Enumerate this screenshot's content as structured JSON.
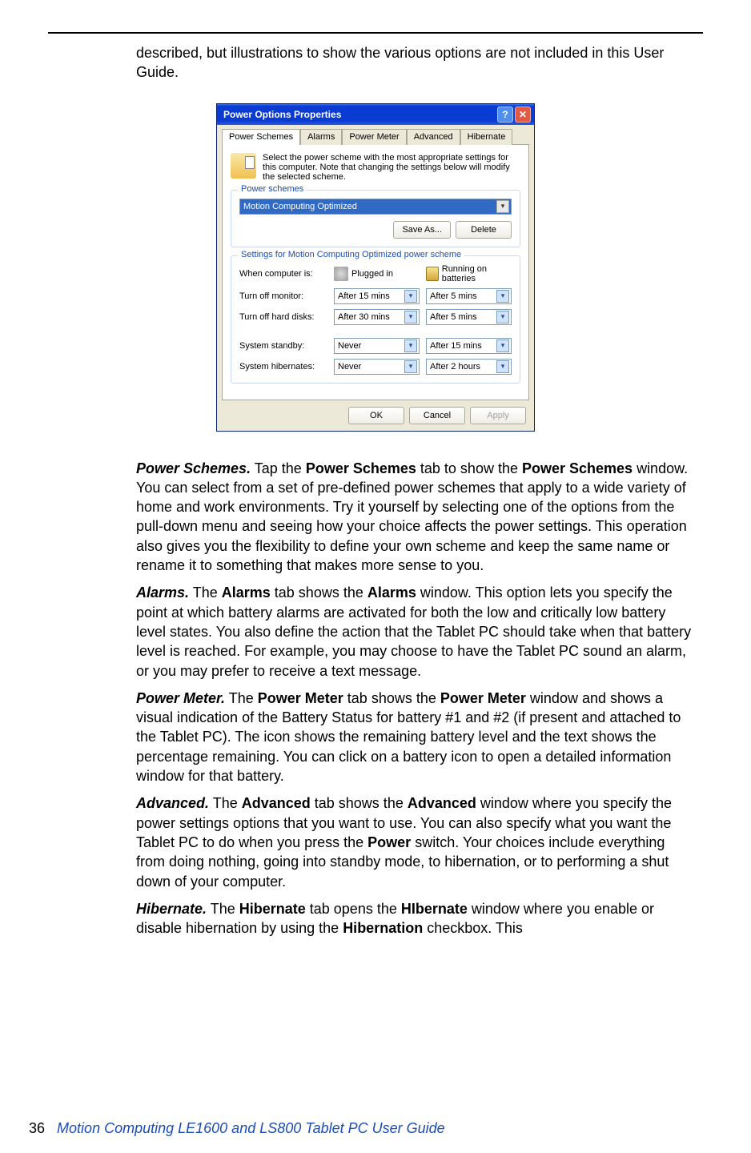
{
  "intro_top": "described, but illustrations to show the various options are not included in this User Guide.",
  "dialog": {
    "title": "Power Options Properties",
    "tabs": [
      "Power Schemes",
      "Alarms",
      "Power Meter",
      "Advanced",
      "Hibernate"
    ],
    "intro": "Select the power scheme with the most appropriate settings for this computer. Note that changing the settings below will modify the selected scheme.",
    "power_schemes_legend": "Power schemes",
    "scheme_selected": "Motion Computing Optimized",
    "save_as": "Save As...",
    "delete": "Delete",
    "settings_legend": "Settings for Motion Computing Optimized power scheme",
    "col_when": "When computer is:",
    "col_plugged": "Plugged in",
    "col_battery": "Running on batteries",
    "rows": {
      "monitor": {
        "label": "Turn off monitor:",
        "plugged": "After 15 mins",
        "battery": "After 5 mins"
      },
      "disks": {
        "label": "Turn off hard disks:",
        "plugged": "After 30 mins",
        "battery": "After 5 mins"
      },
      "standby": {
        "label": "System standby:",
        "plugged": "Never",
        "battery": "After 15 mins"
      },
      "hiber": {
        "label": "System hibernates:",
        "plugged": "Never",
        "battery": "After 2 hours"
      }
    },
    "ok": "OK",
    "cancel": "Cancel",
    "apply": "Apply"
  },
  "sections": {
    "ps_head": "Power Schemes.",
    "ps_body1": " Tap the ",
    "ps_b1": "Power Schemes",
    "ps_body2": " tab to show the ",
    "ps_b2": "Power Schemes",
    "ps_body3": " window. You can select from a set of pre-defined power schemes that apply to a wide variety of home and work environments. Try it yourself by selecting one of the options from the pull-down menu and seeing how your choice affects the power settings. This operation also gives you the flexibility to define your own scheme and keep the same name or rename it to something that makes more sense to you.",
    "al_head": "Alarms.",
    "al_body1": " The ",
    "al_b1": "Alarms",
    "al_body2": " tab shows the ",
    "al_b2": "Alarms",
    "al_body3": " window. This option lets you specify the point at which battery alarms are activated for both the low and critically low battery level states. You also define the action that the Tablet PC should take when that battery level is reached. For example, you may choose to have the Tablet PC sound an alarm, or you may prefer to receive a text message.",
    "pm_head": "Power Meter.",
    "pm_body1": " The ",
    "pm_b1": "Power Meter",
    "pm_body2": " tab shows the ",
    "pm_b2": "Power Meter",
    "pm_body3": " window and shows a visual indication of the Battery Status for battery #1 and #2 (if present and attached to the Tablet PC). The icon shows the remaining battery level and the text shows the percentage remaining. You can click on a battery icon to open a detailed information window for that battery.",
    "ad_head": "Advanced.",
    "ad_body1": " The ",
    "ad_b1": "Advanced",
    "ad_body2": " tab shows the ",
    "ad_b2": "Advanced",
    "ad_body3": " window where you specify the power settings options that you want to use. You can also specify what you want the Tablet PC to do when you press the ",
    "ad_b3": "Power",
    "ad_body4": " switch. Your choices include everything from doing nothing, going into standby mode, to hibernation, or to performing a shut down of your computer.",
    "hb_head": "Hibernate.",
    "hb_body1": " The ",
    "hb_b1": "Hibernate",
    "hb_body2": " tab opens the ",
    "hb_b2": "HIbernate",
    "hb_body3": " window where you enable or disable hibernation by using the ",
    "hb_b3": "Hibernation",
    "hb_body4": " checkbox. This"
  },
  "footer": {
    "page": "36",
    "guide": "Motion Computing LE1600 and LS800 Tablet PC User Guide"
  }
}
